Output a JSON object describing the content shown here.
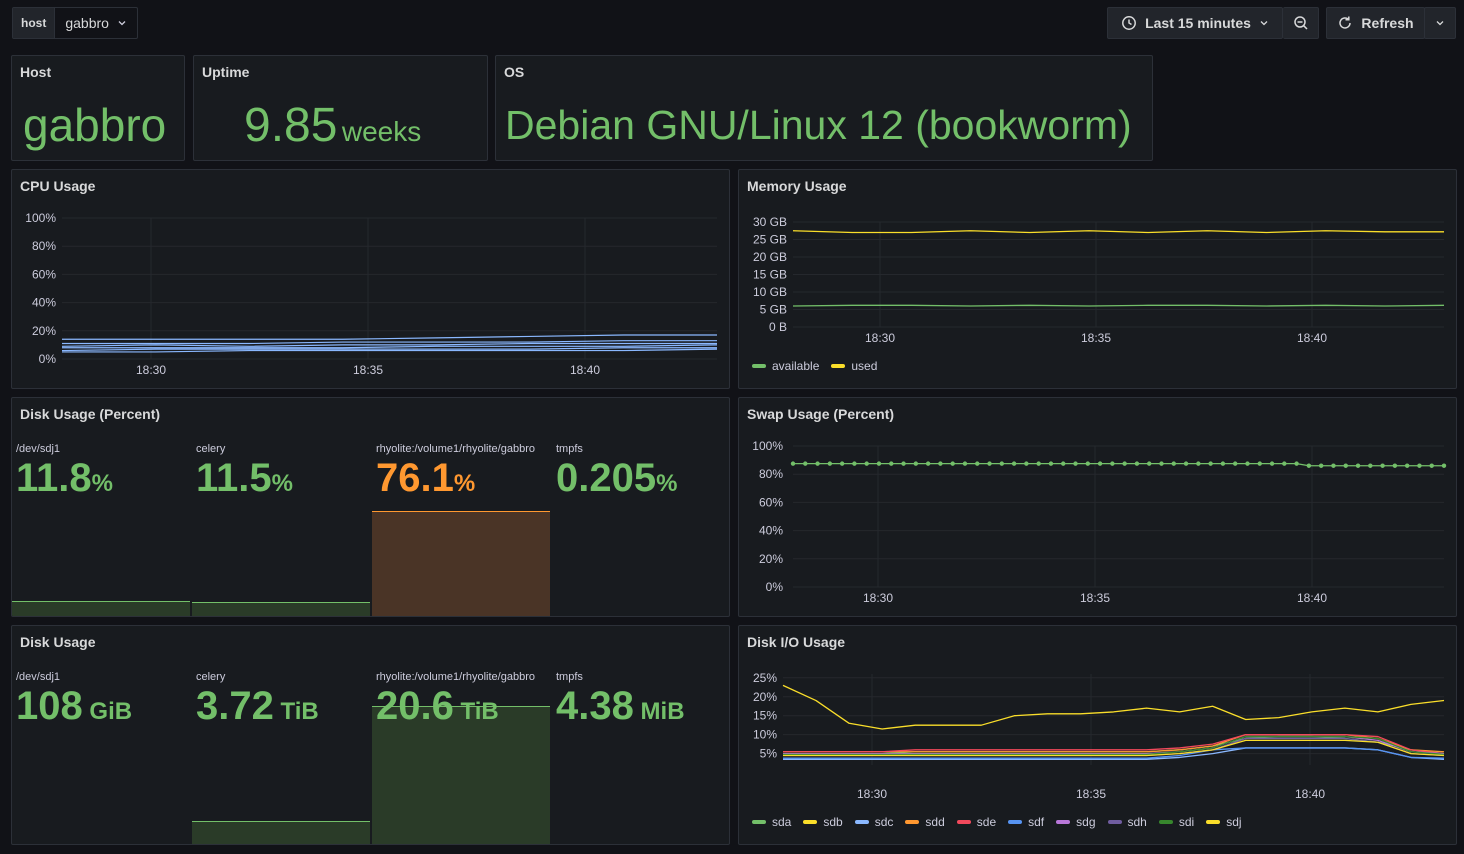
{
  "toolbar": {
    "var_label": "host",
    "var_value": "gabbro",
    "time_range": "Last 15 minutes",
    "refresh_label": "Refresh"
  },
  "stats": {
    "host": {
      "title": "Host",
      "value": "gabbro"
    },
    "uptime": {
      "title": "Uptime",
      "value": "9.85",
      "unit": "weeks"
    },
    "os": {
      "title": "OS",
      "value": "Debian GNU/Linux 12 (bookworm)"
    }
  },
  "panels": {
    "cpu": {
      "title": "CPU Usage"
    },
    "memory": {
      "title": "Memory Usage"
    },
    "disk_pct": {
      "title": "Disk Usage (Percent)"
    },
    "swap": {
      "title": "Swap Usage (Percent)"
    },
    "disk": {
      "title": "Disk Usage"
    },
    "diskio": {
      "title": "Disk I/O Usage"
    }
  },
  "colors": {
    "green": "#73bf69",
    "yellow": "#fade2a",
    "blue": "#8ab8ff",
    "orange": "#ff9830",
    "red": "#f2495c",
    "lightblue": "#5794f2",
    "purple": "#b877d9",
    "lavender": "#705da0",
    "darkgreen": "#37872d",
    "bar_green": "#2a3b28",
    "bar_orange": "#4a3426"
  },
  "disk_pct": [
    {
      "label": "/dev/sdj1",
      "value": "11.8",
      "unit": "%",
      "pct": 11.8,
      "color": "#73bf69"
    },
    {
      "label": "celery",
      "value": "11.5",
      "unit": "%",
      "pct": 11.5,
      "color": "#73bf69"
    },
    {
      "label": "rhyolite:/volume1/rhyolite/gabbro",
      "value": "76.1",
      "unit": "%",
      "pct": 76.1,
      "color": "#ff9830"
    },
    {
      "label": "tmpfs",
      "value": "0.205",
      "unit": "%",
      "pct": 0.205,
      "color": "#73bf69"
    }
  ],
  "disk_usage": [
    {
      "label": "/dev/sdj1",
      "value": "108",
      "unit": "GiB",
      "pct": 0.5,
      "color": "#73bf69"
    },
    {
      "label": "celery",
      "value": "3.72",
      "unit": "TiB",
      "pct": 18,
      "color": "#73bf69"
    },
    {
      "label": "rhyolite:/volume1/rhyolite/gabbro",
      "value": "20.6",
      "unit": "TiB",
      "pct": 100,
      "color": "#73bf69"
    },
    {
      "label": "tmpfs",
      "value": "4.38",
      "unit": "MiB",
      "pct": 0,
      "color": "#73bf69"
    }
  ],
  "chart_data": [
    {
      "id": "cpu",
      "type": "line",
      "title": "CPU Usage",
      "x_ticks": [
        "18:30",
        "18:35",
        "18:40"
      ],
      "y_ticks": [
        "0%",
        "20%",
        "40%",
        "60%",
        "80%",
        "100%"
      ],
      "ylim": [
        0,
        100
      ],
      "series": [
        {
          "values": [
            14,
            14,
            14,
            14,
            15,
            16,
            17,
            17
          ]
        },
        {
          "values": [
            11,
            11,
            11,
            12,
            12,
            12,
            13,
            13
          ]
        },
        {
          "values": [
            9,
            10,
            9,
            10,
            10,
            11,
            11,
            11
          ]
        },
        {
          "values": [
            8,
            8,
            8,
            8,
            9,
            9,
            9,
            10
          ]
        },
        {
          "values": [
            6,
            7,
            7,
            7,
            7,
            7,
            8,
            8
          ]
        },
        {
          "values": [
            5,
            5,
            6,
            6,
            6,
            6,
            6,
            7
          ]
        }
      ]
    },
    {
      "id": "memory",
      "type": "line",
      "title": "Memory Usage",
      "x_ticks": [
        "18:30",
        "18:35",
        "18:40"
      ],
      "y_ticks": [
        "0 B",
        "5 GB",
        "10 GB",
        "15 GB",
        "20 GB",
        "25 GB",
        "30 GB"
      ],
      "ylim": [
        0,
        30
      ],
      "legend": "bottom",
      "series": [
        {
          "name": "available",
          "color": "#73bf69",
          "values": [
            6,
            6.2,
            6.2,
            6,
            6.2,
            6,
            6.2,
            6.2,
            6,
            6.2,
            6,
            6.2
          ]
        },
        {
          "name": "used",
          "color": "#fade2a",
          "values": [
            27.5,
            27,
            27,
            27.5,
            27,
            27.5,
            27,
            27.5,
            27,
            27.5,
            27.2,
            27.2
          ]
        }
      ]
    },
    {
      "id": "swap",
      "type": "line",
      "title": "Swap Usage (Percent)",
      "x_ticks": [
        "18:30",
        "18:35",
        "18:40"
      ],
      "y_ticks": [
        "0%",
        "20%",
        "40%",
        "60%",
        "80%",
        "100%"
      ],
      "ylim": [
        0,
        100
      ],
      "series": [
        {
          "color": "#73bf69",
          "values": [
            87.5,
            87.5,
            87.5,
            87.5,
            87.5,
            87.5,
            87.5,
            87.5,
            87.5,
            87.5,
            87.5,
            87.5,
            87.5,
            87.5,
            87.5,
            87.5,
            87.5,
            87.5,
            87.5,
            87.5,
            87.5,
            87.5,
            87.5,
            87.5,
            87.5,
            87.5,
            87.5,
            87.5,
            87.5,
            87.5,
            87.5,
            87.5,
            87.5,
            87.5,
            87.5,
            87.5,
            87.5,
            87.5,
            87.5,
            87.5,
            87.5,
            87.5,
            86,
            86,
            86,
            86,
            86,
            86,
            86,
            86,
            86,
            86,
            86,
            86
          ]
        }
      ]
    },
    {
      "id": "diskio",
      "type": "line",
      "title": "Disk I/O Usage",
      "x_ticks": [
        "18:30",
        "18:35",
        "18:40"
      ],
      "y_ticks": [
        "5%",
        "10%",
        "15%",
        "20%",
        "25%"
      ],
      "ylim": [
        2,
        26
      ],
      "legend": "bottom",
      "series": [
        {
          "name": "sda",
          "color": "#73bf69",
          "values": [
            5,
            5,
            5,
            5,
            5.5,
            5.5,
            5.5,
            5.5,
            5.5,
            5.5,
            5.5,
            5.5,
            6,
            7,
            9,
            9.5,
            9.5,
            9,
            8,
            6,
            5
          ]
        },
        {
          "name": "sdb",
          "color": "#fade2a",
          "values": [
            23,
            19,
            13,
            11.5,
            12.5,
            12.5,
            12.5,
            15,
            15.5,
            15.5,
            16,
            17,
            16,
            17.5,
            14,
            14.5,
            16,
            17,
            16,
            18,
            19
          ]
        },
        {
          "name": "sdc",
          "color": "#8ab8ff",
          "values": [
            3.5,
            3.5,
            3.5,
            3.5,
            3.5,
            3.5,
            3.5,
            3.5,
            3.5,
            3.5,
            3.5,
            3.5,
            4,
            5,
            6.5,
            6.5,
            6.5,
            6.5,
            6,
            4,
            3.5
          ]
        },
        {
          "name": "sdd",
          "color": "#ff9830",
          "values": [
            5.5,
            5.5,
            5.5,
            5.5,
            5.5,
            5.5,
            5.5,
            5.5,
            5.5,
            5.5,
            5.5,
            5.5,
            6,
            7,
            10,
            10,
            10,
            10,
            9,
            6,
            5.5
          ]
        },
        {
          "name": "sde",
          "color": "#f2495c",
          "values": [
            5.5,
            5.5,
            5.5,
            5.5,
            6,
            6,
            6,
            6,
            6,
            6,
            6,
            6,
            6.5,
            7.5,
            10,
            10,
            10,
            10,
            9.5,
            6,
            5
          ]
        },
        {
          "name": "sdf",
          "color": "#5794f2",
          "values": [
            3.8,
            3.8,
            3.8,
            3.8,
            3.8,
            3.8,
            3.8,
            3.8,
            3.8,
            3.8,
            3.8,
            3.8,
            4.5,
            6,
            6.5,
            6.5,
            6.5,
            6.5,
            6,
            4,
            3.8
          ]
        },
        {
          "name": "sdg",
          "color": "#b877d9",
          "values": [
            5,
            5,
            5,
            5,
            5,
            5,
            5,
            5,
            5,
            5,
            5,
            5,
            5.5,
            6.5,
            9.5,
            9.5,
            9.5,
            9.5,
            8.5,
            5.5,
            5
          ]
        },
        {
          "name": "sdh",
          "color": "#705da0",
          "values": [
            4.5,
            4.5,
            4.5,
            4.5,
            4.5,
            4.5,
            4.5,
            4.5,
            4.5,
            4.5,
            4.5,
            4.5,
            5,
            6,
            9,
            9,
            9,
            9,
            8,
            5,
            4.5
          ]
        },
        {
          "name": "sdi",
          "color": "#37872d",
          "values": [
            4.8,
            4.8,
            4.8,
            4.8,
            4.8,
            4.8,
            4.8,
            4.8,
            4.8,
            4.8,
            4.8,
            4.8,
            5.5,
            6.5,
            9.5,
            9.5,
            9.5,
            9.5,
            9,
            5.5,
            4.8
          ]
        },
        {
          "name": "sdj",
          "color": "#fade2a",
          "values": [
            4.5,
            4.5,
            4.5,
            4.5,
            4.5,
            4.5,
            4.5,
            4.5,
            4.5,
            4.5,
            4.5,
            4.5,
            5,
            6,
            8.5,
            8.5,
            8.5,
            8.5,
            8,
            5,
            4.5
          ]
        }
      ]
    }
  ]
}
